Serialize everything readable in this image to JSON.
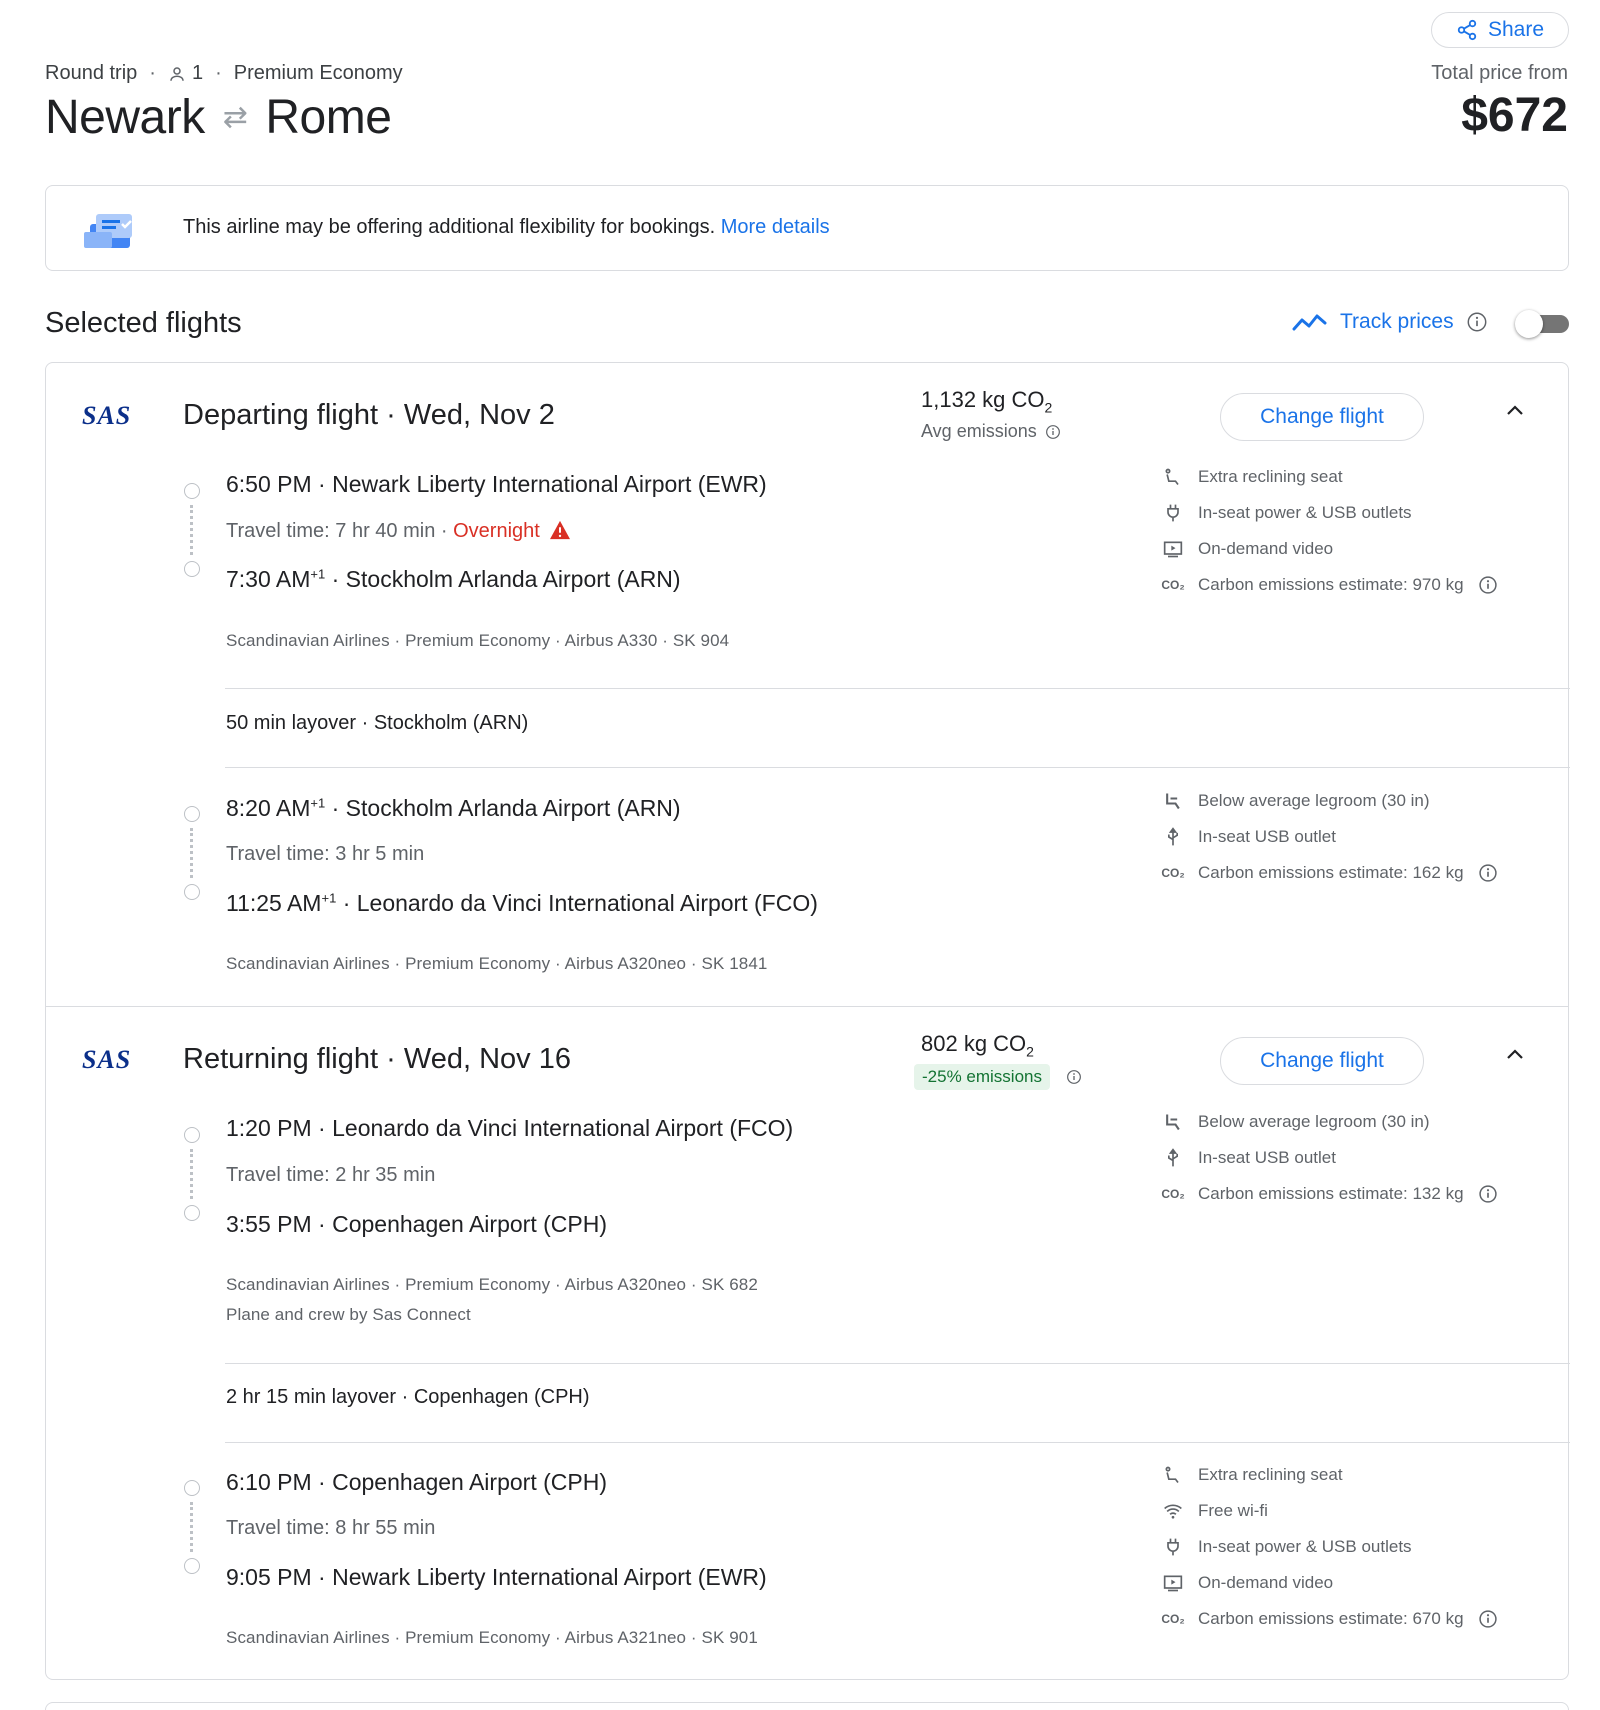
{
  "header": {
    "share_label": "Share",
    "trip_type": "Round trip",
    "passengers": "1",
    "cabin": "Premium Economy",
    "origin": "Newark",
    "destination": "Rome",
    "total_label": "Total price from",
    "total_price": "$672"
  },
  "banner": {
    "text": "This airline may be offering additional flexibility for bookings.",
    "link": "More details"
  },
  "selected": {
    "title": "Selected flights",
    "track_label": "Track prices"
  },
  "departing": {
    "airline_logo": "SAS",
    "title": "Departing flight",
    "date": "Wed, Nov 2",
    "co2_value": "1,132 kg CO",
    "co2_sub": "2",
    "co2_note": "Avg emissions",
    "change_label": "Change flight",
    "segments": [
      {
        "dep_time": "6:50 PM",
        "dep_sup": "",
        "dep_airport": "Newark Liberty International Airport (EWR)",
        "travel": "Travel time: 7 hr 40 min",
        "overnight": "Overnight",
        "arr_time": "7:30 AM",
        "arr_sup": "+1",
        "arr_airport": "Stockholm Arlanda Airport (ARN)",
        "details": "Scandinavian Airlines · Premium Economy · Airbus A330 · SK 904",
        "amenities": [
          {
            "icon": "reclining-seat-icon",
            "label": "Extra reclining seat"
          },
          {
            "icon": "power-plug-icon",
            "label": "In-seat power & USB outlets"
          },
          {
            "icon": "video-icon",
            "label": "On-demand video"
          },
          {
            "icon": "co2-icon",
            "label": "Carbon emissions estimate: 970 kg"
          }
        ]
      },
      {
        "dep_time": "8:20 AM",
        "dep_sup": "+1",
        "dep_airport": "Stockholm Arlanda Airport (ARN)",
        "travel": "Travel time: 3 hr 5 min",
        "arr_time": "11:25 AM",
        "arr_sup": "+1",
        "arr_airport": "Leonardo da Vinci International Airport (FCO)",
        "details": "Scandinavian Airlines · Premium Economy · Airbus A320neo · SK 1841",
        "amenities": [
          {
            "icon": "legroom-icon",
            "label": "Below average legroom (30 in)"
          },
          {
            "icon": "usb-icon",
            "label": "In-seat USB outlet"
          },
          {
            "icon": "co2-icon",
            "label": "Carbon emissions estimate: 162 kg"
          }
        ]
      }
    ],
    "layover": "50 min layover · Stockholm (ARN)"
  },
  "returning": {
    "airline_logo": "SAS",
    "title": "Returning flight",
    "date": "Wed, Nov 16",
    "co2_value": "802 kg CO",
    "co2_sub": "2",
    "co2_badge": "-25% emissions",
    "change_label": "Change flight",
    "segments": [
      {
        "dep_time": "1:20 PM",
        "dep_airport": "Leonardo da Vinci International Airport (FCO)",
        "travel": "Travel time: 2 hr 35 min",
        "arr_time": "3:55 PM",
        "arr_airport": "Copenhagen Airport (CPH)",
        "details": "Scandinavian Airlines · Premium Economy · Airbus A320neo · SK 682",
        "details2": "Plane and crew by Sas Connect",
        "amenities": [
          {
            "icon": "legroom-icon",
            "label": "Below average legroom (30 in)"
          },
          {
            "icon": "usb-icon",
            "label": "In-seat USB outlet"
          },
          {
            "icon": "co2-icon",
            "label": "Carbon emissions estimate: 132 kg"
          }
        ]
      },
      {
        "dep_time": "6:10 PM",
        "dep_airport": "Copenhagen Airport (CPH)",
        "travel": "Travel time: 8 hr 55 min",
        "arr_time": "9:05 PM",
        "arr_airport": "Newark Liberty International Airport (EWR)",
        "details": "Scandinavian Airlines · Premium Economy · Airbus A321neo · SK 901",
        "amenities": [
          {
            "icon": "reclining-seat-icon",
            "label": "Extra reclining seat"
          },
          {
            "icon": "wifi-icon",
            "label": "Free wi-fi"
          },
          {
            "icon": "power-plug-icon",
            "label": "In-seat power & USB outlets"
          },
          {
            "icon": "video-icon",
            "label": "On-demand video"
          },
          {
            "icon": "co2-icon",
            "label": "Carbon emissions estimate: 670 kg"
          }
        ]
      }
    ],
    "layover": "2 hr 15 min layover · Copenhagen (CPH)"
  },
  "colors": {
    "accent": "#1a73e8",
    "warning": "#d93025",
    "eco_bg": "#e6f4ea",
    "eco_text": "#137333",
    "border": "#dadce0"
  }
}
